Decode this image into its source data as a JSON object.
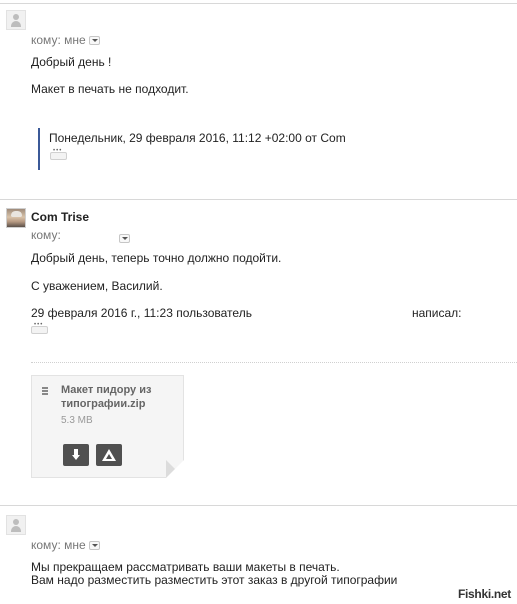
{
  "message1": {
    "to_label": "кому: мне",
    "greeting": "Добрый день !",
    "body": "Макет в печать не подходит.",
    "quote_header": "Понедельник, 29 февраля 2016, 11:12 +02:00 от Com Trise"
  },
  "message2": {
    "sender": "Com Trise",
    "to_label": "кому:",
    "line1": "Добрый день, теперь точно должно подойти.",
    "line2": "С уважением, Василий.",
    "quote_header": "29 февраля 2016 г., 11:23 пользователь",
    "quote_wrote": "написал:",
    "attachment": {
      "name": "Макет пидору из типографии.zip",
      "size": "5.3 MB",
      "icons": [
        "zip-icon",
        "download-icon",
        "drive-icon"
      ]
    }
  },
  "message3": {
    "to_label": "кому: мне",
    "line1": "Мы прекращаем рассматривать ваши макеты в печать.",
    "line2": "Вам надо разместить разместить этот заказ в другой типографии"
  },
  "watermark": "Fishki.net",
  "colors": {
    "quote_bar": "#3b5998",
    "button_bg": "#505050"
  }
}
